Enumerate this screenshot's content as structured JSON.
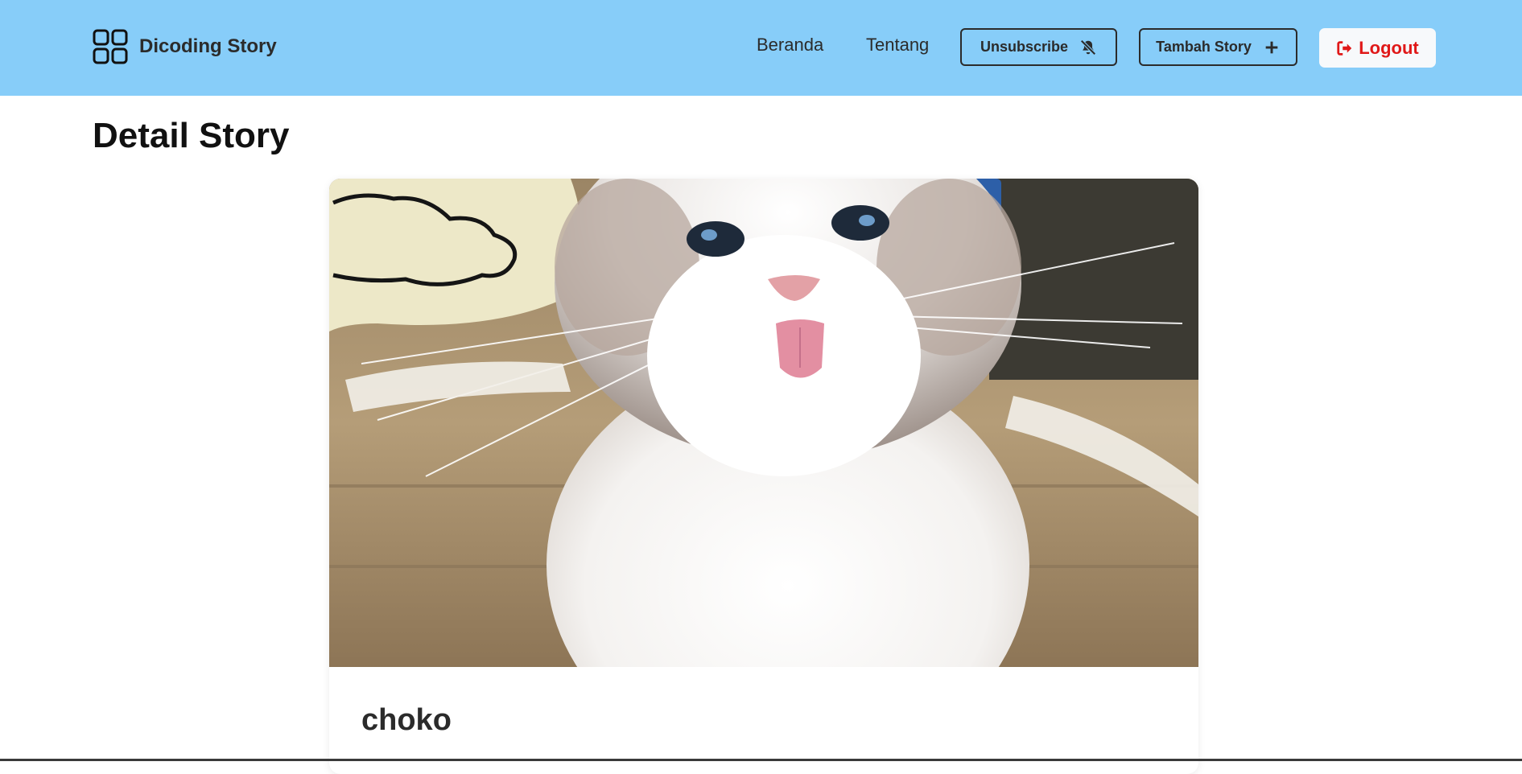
{
  "header": {
    "brand_name": "Dicoding Story",
    "brand_icon": "grid-apps-icon",
    "background": "#87cdf9",
    "nav": [
      {
        "label": "Beranda"
      },
      {
        "label": "Tentang"
      }
    ],
    "unsubscribe": {
      "label": "Unsubscribe",
      "icon": "bell-slash-icon"
    },
    "add_story": {
      "label": "Tambah Story",
      "icon": "plus-icon"
    },
    "logout": {
      "label": "Logout",
      "icon": "sign-out-icon",
      "color": "#e01818"
    }
  },
  "main": {
    "title": "Detail Story",
    "story": {
      "name": "choko",
      "photo_subject": "white fluffy ragdoll cat sticking out tongue"
    }
  }
}
